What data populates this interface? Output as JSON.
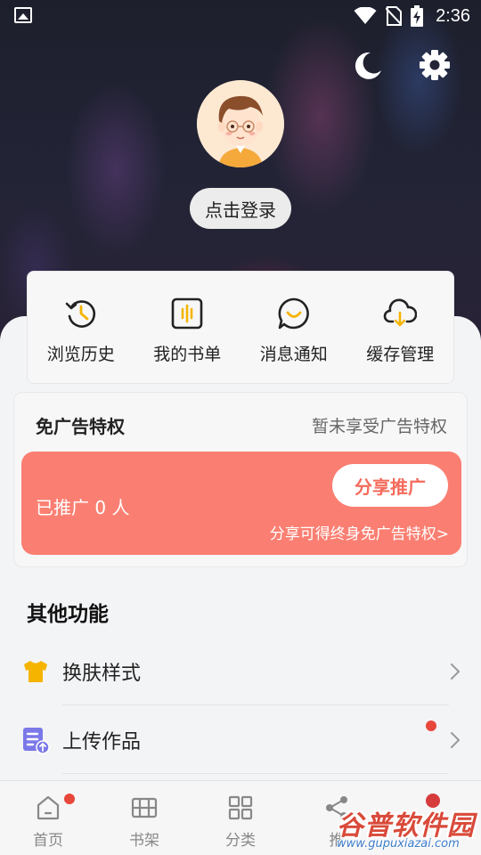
{
  "status_bar": {
    "time": "2:36"
  },
  "header": {
    "login_label": "点击登录"
  },
  "quick_actions": [
    {
      "label": "浏览历史",
      "icon": "history-icon"
    },
    {
      "label": "我的书单",
      "icon": "booklist-icon"
    },
    {
      "label": "消息通知",
      "icon": "message-icon"
    },
    {
      "label": "缓存管理",
      "icon": "cloud-download-icon"
    }
  ],
  "ad_free": {
    "title": "免广告特权",
    "status": "暂未享受广告特权",
    "promoted_count": "已推广 0 人",
    "share_button": "分享推广",
    "note": "分享可得终身免广告特权>"
  },
  "other_functions": {
    "title": "其他功能",
    "items": [
      {
        "label": "换肤样式",
        "icon": "tshirt-icon",
        "has_dot": false
      },
      {
        "label": "上传作品",
        "icon": "upload-doc-icon",
        "has_dot": true
      }
    ]
  },
  "bottom_nav": [
    {
      "label": "首页",
      "icon": "home-icon",
      "has_dot": true
    },
    {
      "label": "书架",
      "icon": "bookshelf-icon",
      "has_dot": false
    },
    {
      "label": "分类",
      "icon": "category-icon",
      "has_dot": false
    },
    {
      "label": "推",
      "icon": "share-icon",
      "has_dot": false
    },
    {
      "label": "",
      "icon": "profile-icon",
      "has_dot": true
    }
  ],
  "watermark": {
    "main": "谷普软件园",
    "sub": "www.gupuxiazai.com"
  },
  "colors": {
    "promo": "#fa7f72",
    "dot": "#e8473c",
    "accent_yellow": "#f5b400",
    "accent_purple": "#7b78e8"
  }
}
